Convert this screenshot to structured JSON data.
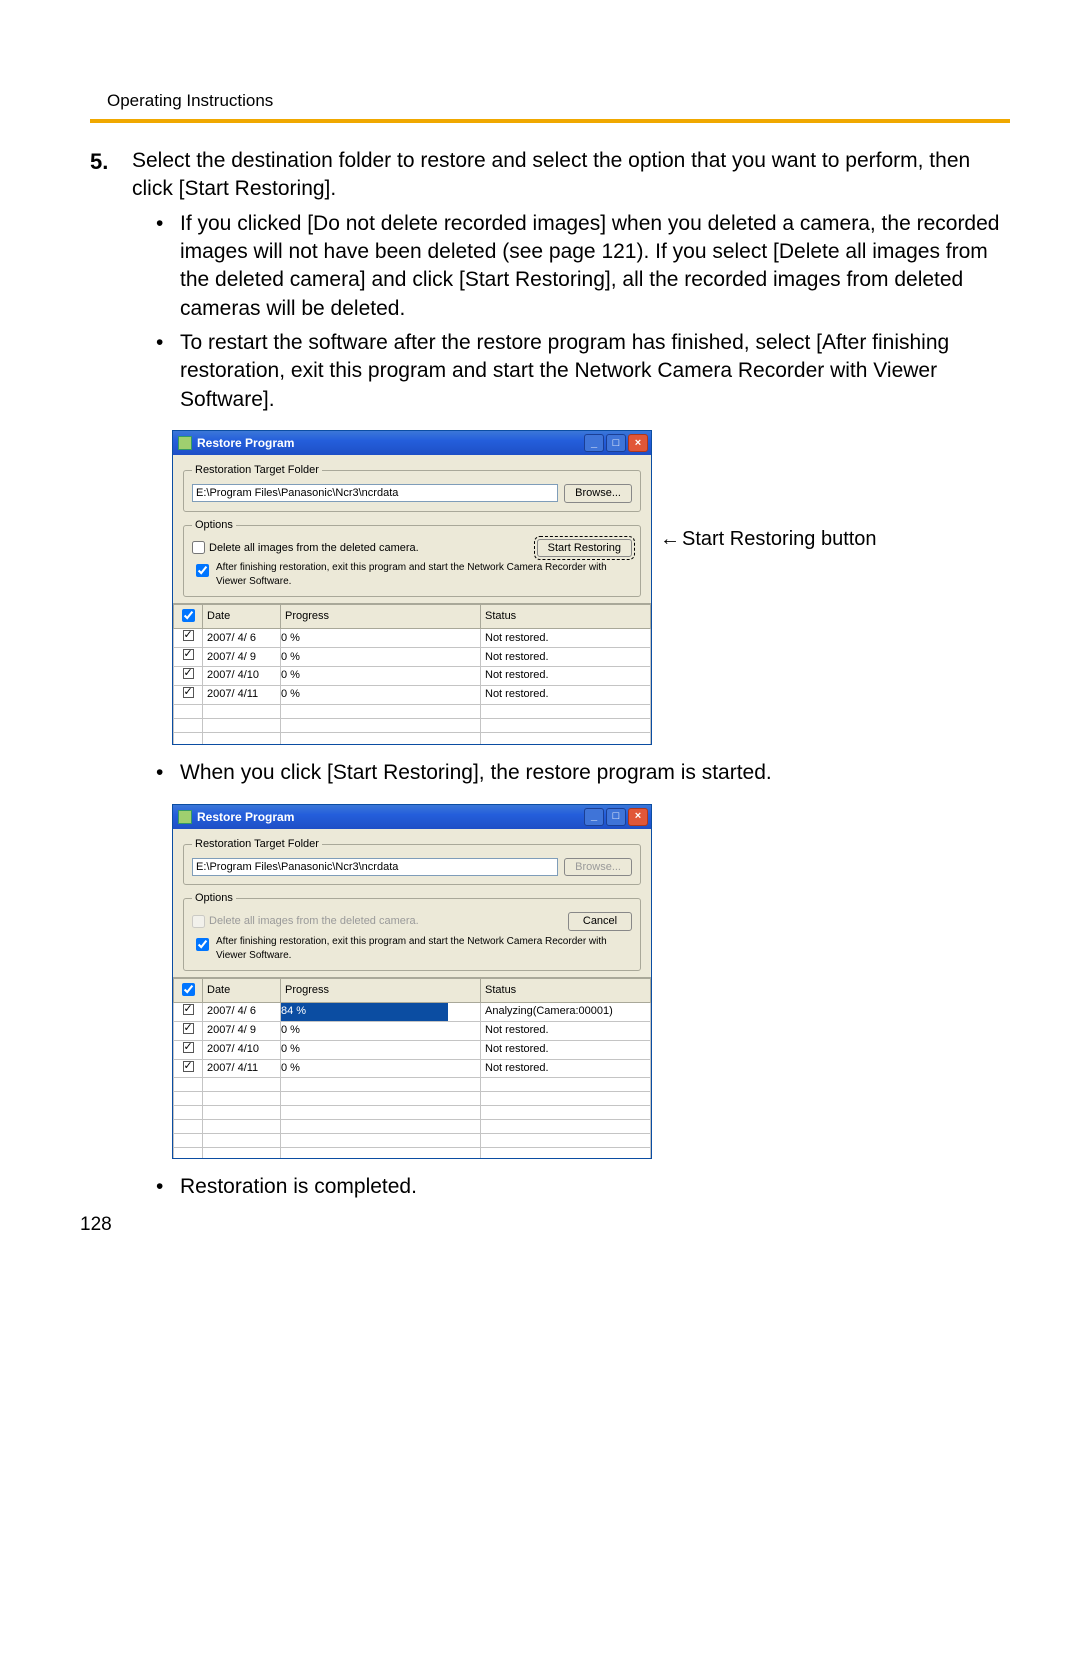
{
  "header": {
    "title": "Operating Instructions"
  },
  "step": {
    "num": "5.",
    "text": "Select the destination folder to restore and select the option that you want to perform, then click [Start Restoring].",
    "bullets_top": [
      "If you clicked [Do not delete recorded images] when you deleted a camera, the recorded images will not have been deleted (see page 121). If you select [Delete all images from the deleted camera] and click [Start Restoring], all the recorded images from deleted cameras will be deleted.",
      "To restart the software after the restore program has finished, select [After finishing restoration, exit this program and start the Network Camera Recorder with Viewer Software]."
    ],
    "bullet_mid": "When you click [Start Restoring], the restore program is started.",
    "bullet_end": "Restoration is completed."
  },
  "annotation": {
    "start_restoring": "Start Restoring button"
  },
  "win_common": {
    "title": "Restore Program",
    "target_legend": "Restoration Target Folder",
    "path": "E:\\Program Files\\Panasonic\\Ncr3\\ncrdata",
    "browse": "Browse...",
    "options_legend": "Options",
    "delete_label": "Delete all images from the deleted camera.",
    "after_label": "After finishing restoration, exit this program and start the Network Camera Recorder with Viewer Software.",
    "start_btn": "Start Restoring",
    "cancel_btn": "Cancel",
    "cols": {
      "date": "Date",
      "progress": "Progress",
      "status": "Status"
    }
  },
  "shot1_rows": [
    {
      "date": "2007/ 4/ 6",
      "progress_pct": 0,
      "progress_label": "0 %",
      "status": "Not restored."
    },
    {
      "date": "2007/ 4/ 9",
      "progress_pct": 0,
      "progress_label": "0 %",
      "status": "Not restored."
    },
    {
      "date": "2007/ 4/10",
      "progress_pct": 0,
      "progress_label": "0 %",
      "status": "Not restored."
    },
    {
      "date": "2007/ 4/11",
      "progress_pct": 0,
      "progress_label": "0 %",
      "status": "Not restored."
    }
  ],
  "shot2_rows": [
    {
      "date": "2007/ 4/ 6",
      "progress_pct": 84,
      "progress_label": "84 %",
      "status": "Analyzing(Camera:00001)"
    },
    {
      "date": "2007/ 4/ 9",
      "progress_pct": 0,
      "progress_label": "0 %",
      "status": "Not restored."
    },
    {
      "date": "2007/ 4/10",
      "progress_pct": 0,
      "progress_label": "0 %",
      "status": "Not restored."
    },
    {
      "date": "2007/ 4/11",
      "progress_pct": 0,
      "progress_label": "0 %",
      "status": "Not restored."
    }
  ],
  "page_number": "128"
}
